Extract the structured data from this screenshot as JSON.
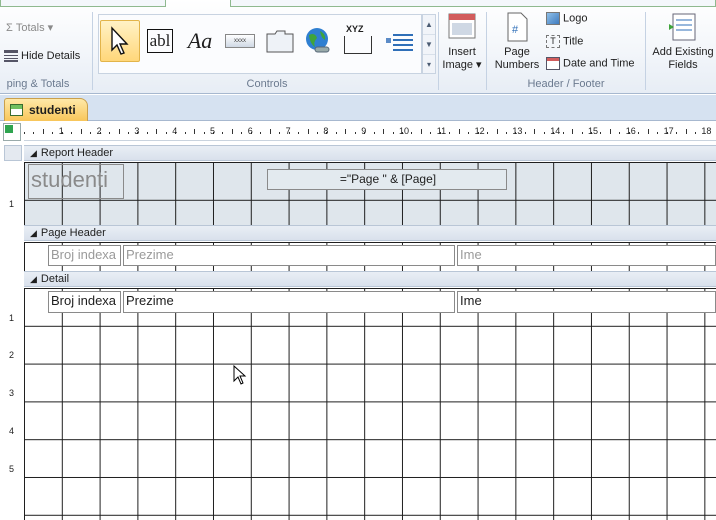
{
  "ribbon": {
    "totals": "Totals",
    "hide_details": "Hide Details",
    "grouping_group_label": "ping & Totals",
    "controls_group_label": "Controls",
    "insert_image": "Insert",
    "insert_image_2": "Image",
    "page_numbers_1": "Page",
    "page_numbers_2": "Numbers",
    "logo": "Logo",
    "title": "Title",
    "date_time": "Date and Time",
    "header_footer_group_label": "Header / Footer",
    "add_existing_1": "Add Existing",
    "add_existing_2": "Fields",
    "label_control_text": "Aa",
    "textbox_control_text": "abl",
    "xyz_text": "XYZ"
  },
  "document_tab": {
    "label": "studenti"
  },
  "ruler": {
    "marks": [
      "1",
      "2",
      "3",
      "4",
      "5",
      "6",
      "7",
      "8",
      "9",
      "10",
      "11",
      "12",
      "13",
      "14",
      "15",
      "16",
      "17",
      "18"
    ],
    "vmarks": [
      "1",
      "1",
      "2",
      "3",
      "4",
      "5"
    ]
  },
  "sections": {
    "report_header": "Report Header",
    "page_header": "Page Header",
    "detail": "Detail"
  },
  "report_header": {
    "title": "studenti",
    "page_expr": "=\"Page \" & [Page]"
  },
  "page_header": {
    "col1": "Broj indexa",
    "col2": "Prezime",
    "col3": "Ime"
  },
  "detail": {
    "col1": "Broj indexa",
    "col2": "Prezime",
    "col3": "Ime"
  }
}
